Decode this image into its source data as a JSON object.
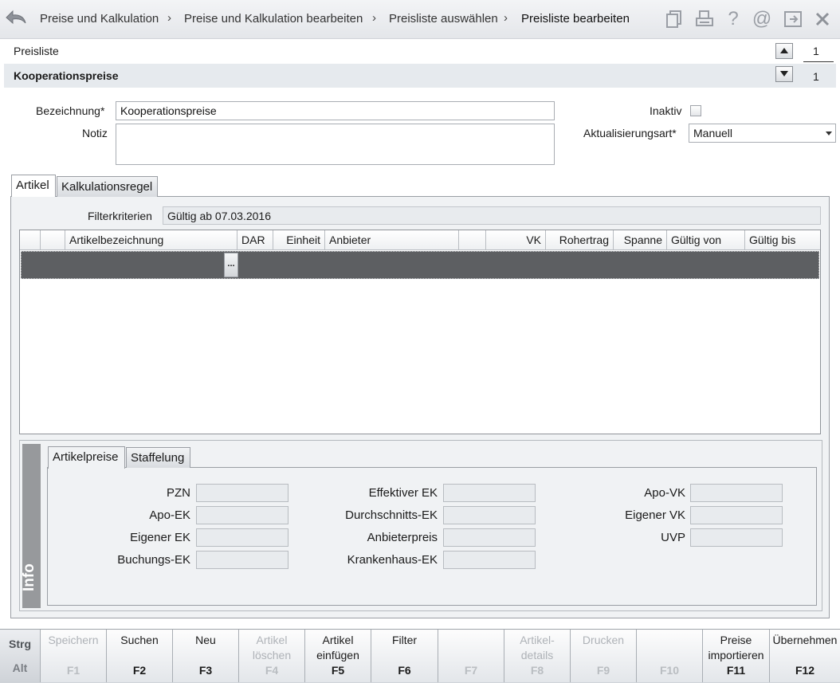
{
  "header": {
    "breadcrumbs": [
      "Preise und Kalkulation",
      "Preise und Kalkulation bearbeiten",
      "Preisliste auswählen",
      "Preisliste bearbeiten"
    ],
    "separator": "›",
    "icons": [
      "copy-icon",
      "print-icon",
      "help-icon",
      "at-icon",
      "exit-icon",
      "close-icon"
    ]
  },
  "record": {
    "section_label": "Preisliste",
    "current_name": "Kooperationspreise",
    "position": "1",
    "total": "1"
  },
  "form": {
    "bezeichnung_label": "Bezeichnung*",
    "bezeichnung_value": "Kooperationspreise",
    "notiz_label": "Notiz",
    "notiz_value": "",
    "inaktiv_label": "Inaktiv",
    "inaktiv_checked": false,
    "aktualisierungsart_label": "Aktualisierungsart*",
    "aktualisierungsart_value": "Manuell"
  },
  "tabs": [
    {
      "label": "Artikel",
      "active": true
    },
    {
      "label": "Kalkulationsregel",
      "active": false
    }
  ],
  "filter": {
    "label": "Filterkriterien",
    "value": "Gültig ab 07.03.2016"
  },
  "grid": {
    "columns": [
      "",
      "",
      "Artikelbezeichnung",
      "DAR",
      "Einheit",
      "Anbieter",
      "",
      "VK",
      "Rohertrag",
      "Spanne",
      "Gültig von",
      "Gültig bis"
    ],
    "rows": [],
    "ellipsis": "..."
  },
  "info": {
    "strip_label": "Info",
    "tabs": [
      {
        "label": "Artikelpreise",
        "active": true
      },
      {
        "label": "Staffelung",
        "active": false
      }
    ],
    "fields": {
      "col1": [
        "PZN",
        "Apo-EK",
        "Eigener EK",
        "Buchungs-EK"
      ],
      "col2": [
        "Effektiver EK",
        "Durchschnitts-EK",
        "Anbieterpreis",
        "Krankenhaus-EK"
      ],
      "col3": [
        "Apo-VK",
        "Eigener VK",
        "UVP"
      ]
    }
  },
  "fkeys": {
    "modifier_top": "Strg",
    "modifier_bottom": "Alt",
    "keys": [
      {
        "label": "Speichern",
        "key": "F1",
        "enabled": false
      },
      {
        "label": "Suchen",
        "key": "F2",
        "enabled": true
      },
      {
        "label": "Neu",
        "key": "F3",
        "enabled": true
      },
      {
        "label": "Artikel\nlöschen",
        "key": "F4",
        "enabled": false
      },
      {
        "label": "Artikel\neinfügen",
        "key": "F5",
        "enabled": true
      },
      {
        "label": "Filter",
        "key": "F6",
        "enabled": true
      },
      {
        "label": "",
        "key": "F7",
        "enabled": false
      },
      {
        "label": "Artikel-\ndetails",
        "key": "F8",
        "enabled": false
      },
      {
        "label": "Drucken",
        "key": "F9",
        "enabled": false
      },
      {
        "label": "",
        "key": "F10",
        "enabled": false
      },
      {
        "label": "Preise\nimportieren",
        "key": "F11",
        "enabled": true
      },
      {
        "label": "Übernehmen",
        "key": "F12",
        "enabled": true
      }
    ]
  },
  "colors": {
    "header_bg": "#e8eaed",
    "selected_row": "#5d5f62",
    "info_strip": "#97999c",
    "disabled_text": "#aeb2b7"
  }
}
